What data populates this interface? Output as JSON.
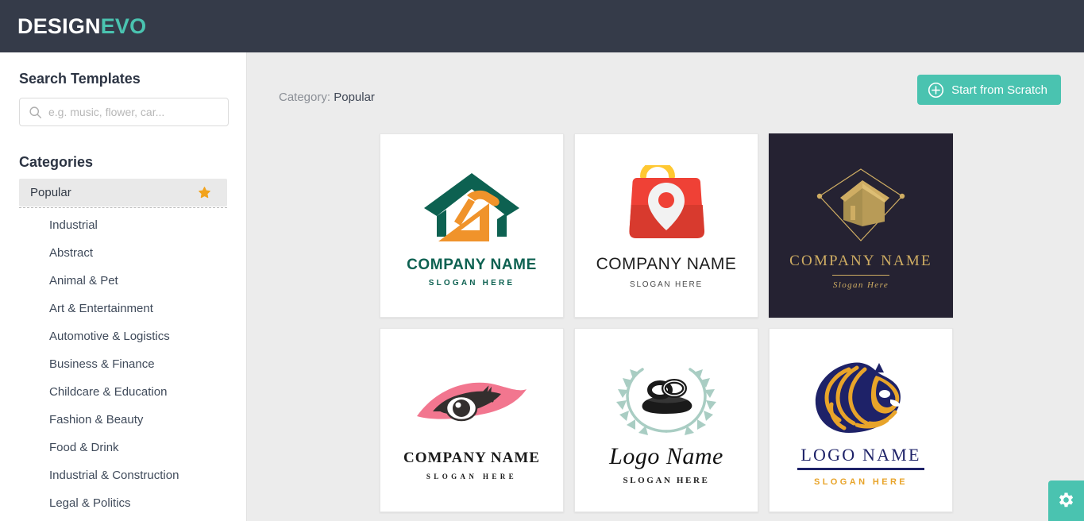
{
  "navbar": {
    "brand_design": "DESIGN",
    "brand_evo": "EVO",
    "background": "#353b49",
    "accent": "#4ac3b0"
  },
  "sidebar": {
    "search_title": "Search Templates",
    "search": {
      "placeholder": "e.g. music, flower, car...",
      "value": "",
      "icon": "search-icon"
    },
    "categories_title": "Categories",
    "active_category": "Popular",
    "active_icon": "star-icon",
    "items": [
      {
        "label": "Popular",
        "active": true,
        "icon": "star-icon"
      },
      {
        "label": "Industrial",
        "active": false
      },
      {
        "label": "Abstract",
        "active": false
      },
      {
        "label": "Animal & Pet",
        "active": false
      },
      {
        "label": "Art & Entertainment",
        "active": false
      },
      {
        "label": "Automotive & Logistics",
        "active": false
      },
      {
        "label": "Business & Finance",
        "active": false
      },
      {
        "label": "Childcare & Education",
        "active": false
      },
      {
        "label": "Fashion & Beauty",
        "active": false
      },
      {
        "label": "Food & Drink",
        "active": false
      },
      {
        "label": "Industrial & Construction",
        "active": false
      },
      {
        "label": "Legal & Politics",
        "active": false
      }
    ]
  },
  "content": {
    "breadcrumb_label": "Category:",
    "breadcrumb_value": "Popular",
    "scratch_button": "Start from Scratch",
    "scratch_icon": "plus-circle-icon",
    "gear_icon": "gear-icon"
  },
  "templates": [
    {
      "id": "card-1",
      "art": "house-hammer-icon",
      "name": "COMPANY NAME",
      "slogan": "SLOGAN HERE",
      "colors": [
        "#0d6151",
        "#f0932b"
      ],
      "background": "#ffffff"
    },
    {
      "id": "card-2",
      "art": "shopping-bag-pin-icon",
      "name": "COMPANY  NAME",
      "slogan": "SLOGAN HERE",
      "colors": [
        "#ef4136",
        "#d83a2e",
        "#ffc832",
        "#f2f2f2"
      ],
      "background": "#ffffff"
    },
    {
      "id": "card-3",
      "art": "gold-house-diamond-icon",
      "name": "COMPANY NAME",
      "slogan": "Slogan Here",
      "colors": [
        "#cfad63"
      ],
      "background": "#252232"
    },
    {
      "id": "card-4",
      "art": "eye-makeup-icon",
      "name": "COMPANY NAME",
      "slogan": "SLOGAN HERE",
      "colors": [
        "#f2768f",
        "#332f2e"
      ],
      "background": "#ffffff"
    },
    {
      "id": "card-5",
      "art": "wedding-rings-wreath-icon",
      "name": "Logo Name",
      "slogan": "SLOGAN HERE",
      "colors": [
        "#a9cdc3",
        "#1a1a1a"
      ],
      "background": "#ffffff"
    },
    {
      "id": "card-6",
      "art": "lion-head-icon",
      "name": "LOGO NAME",
      "slogan": "SLOGAN HERE",
      "colors": [
        "#1e2268",
        "#e8a42a"
      ],
      "background": "#ffffff"
    }
  ]
}
